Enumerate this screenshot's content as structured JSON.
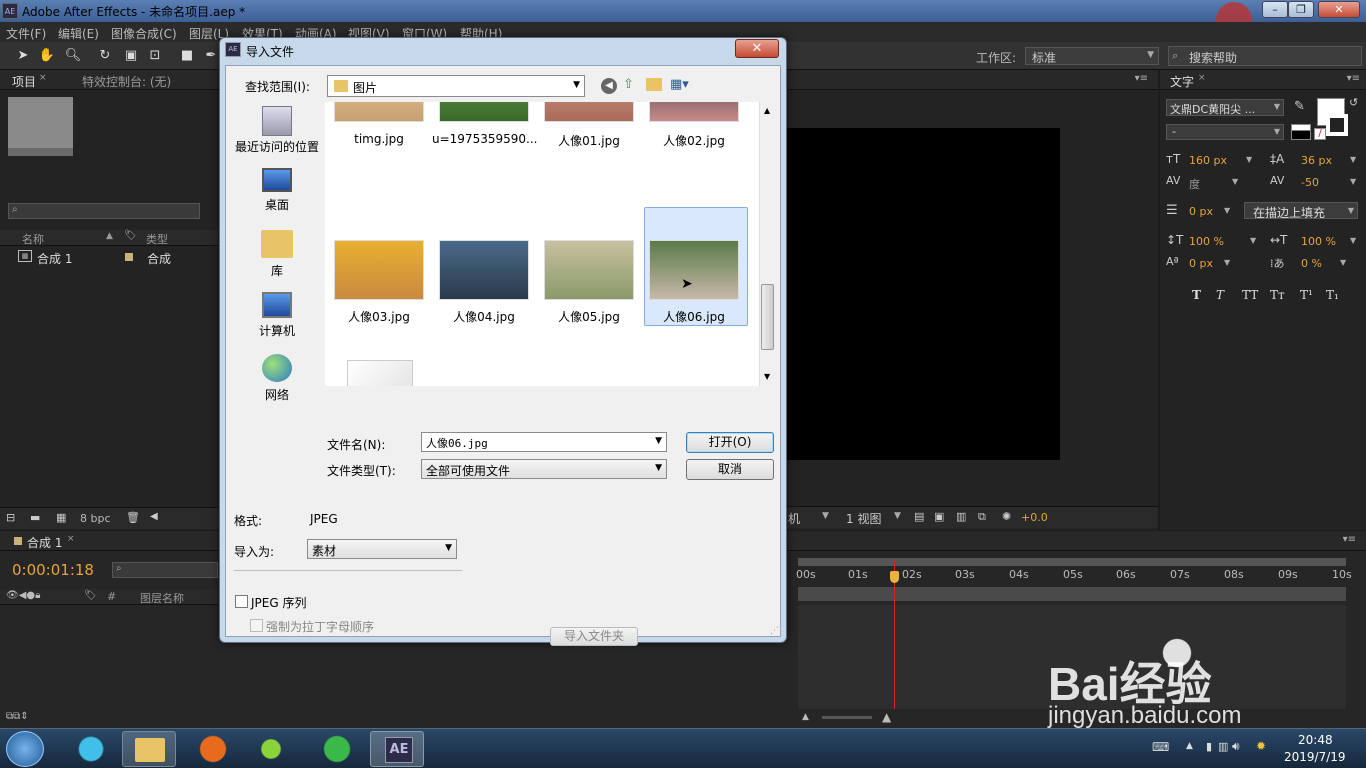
{
  "window": {
    "title": "Adobe After Effects - 未命名项目.aep *",
    "logo": "AE"
  },
  "menu": [
    "文件(F)",
    "编辑(E)",
    "图像合成(C)",
    "图层(L)",
    "效果(T)",
    "动画(A)",
    "视图(V)",
    "窗口(W)",
    "帮助(H)"
  ],
  "workspace": {
    "label": "工作区:",
    "value": "标准",
    "search_placeholder": "搜索帮助"
  },
  "project_panel": {
    "tab_project": "项目",
    "tab_effects": "特效控制台: (无)",
    "col_name": "名称",
    "col_type": "类型",
    "item_name": "合成 1",
    "item_type": "合成",
    "bpc": "8 bpc"
  },
  "timeline": {
    "tab": "合成 1",
    "timecode": "0:00:01:18",
    "col_layer": "图层名称",
    "ruler": [
      "00s",
      "01s",
      "02s",
      "03s",
      "04s",
      "05s",
      "06s",
      "07s",
      "08s",
      "09s",
      "10s"
    ]
  },
  "viewer": {
    "view_label": "1 视图",
    "exposure": "+0.0",
    "region": "机"
  },
  "character_panel": {
    "tab": "文字",
    "font": "文鼎DC黄阳尖 ...",
    "style": "-",
    "font_size": "160 px",
    "leading": "36 px",
    "kerning": "度",
    "tracking": "-50",
    "stroke_width": "0 px",
    "stroke_mode": "在描边上填充",
    "vscale": "100 %",
    "hscale": "100 %",
    "baseline": "0 px",
    "tsume": "0 %",
    "styles": [
      "T",
      "T",
      "TT",
      "Tт",
      "T¹",
      "T₁"
    ]
  },
  "dialog": {
    "title": "导入文件",
    "look_in_label": "查找范围(I):",
    "look_in_value": "图片",
    "places": [
      "最近访问的位置",
      "桌面",
      "库",
      "计算机",
      "网络"
    ],
    "files_row1": [
      "timg.jpg",
      "u=1975359590...",
      "人像01.jpg",
      "人像02.jpg"
    ],
    "files_row2": [
      "人像03.jpg",
      "人像04.jpg",
      "人像05.jpg",
      "人像06.jpg"
    ],
    "filename_label": "文件名(N):",
    "filename_value": "人像06.jpg",
    "filetype_label": "文件类型(T):",
    "filetype_value": "全部可使用文件",
    "open_button": "打开(O)",
    "cancel_button": "取消",
    "format_label": "格式:",
    "format_value": "JPEG",
    "import_as_label": "导入为:",
    "import_as_value": "素材",
    "sequence_label": "JPEG 序列",
    "alpha_order_label": "强制为拉丁字母顺序",
    "import_folder_button": "导入文件夹"
  },
  "taskbar": {
    "time": "20:48",
    "date": "2019/7/19",
    "ae_label": "AE"
  },
  "watermark": {
    "brand": "Bai经验",
    "url": "jingyan.baidu.com"
  }
}
